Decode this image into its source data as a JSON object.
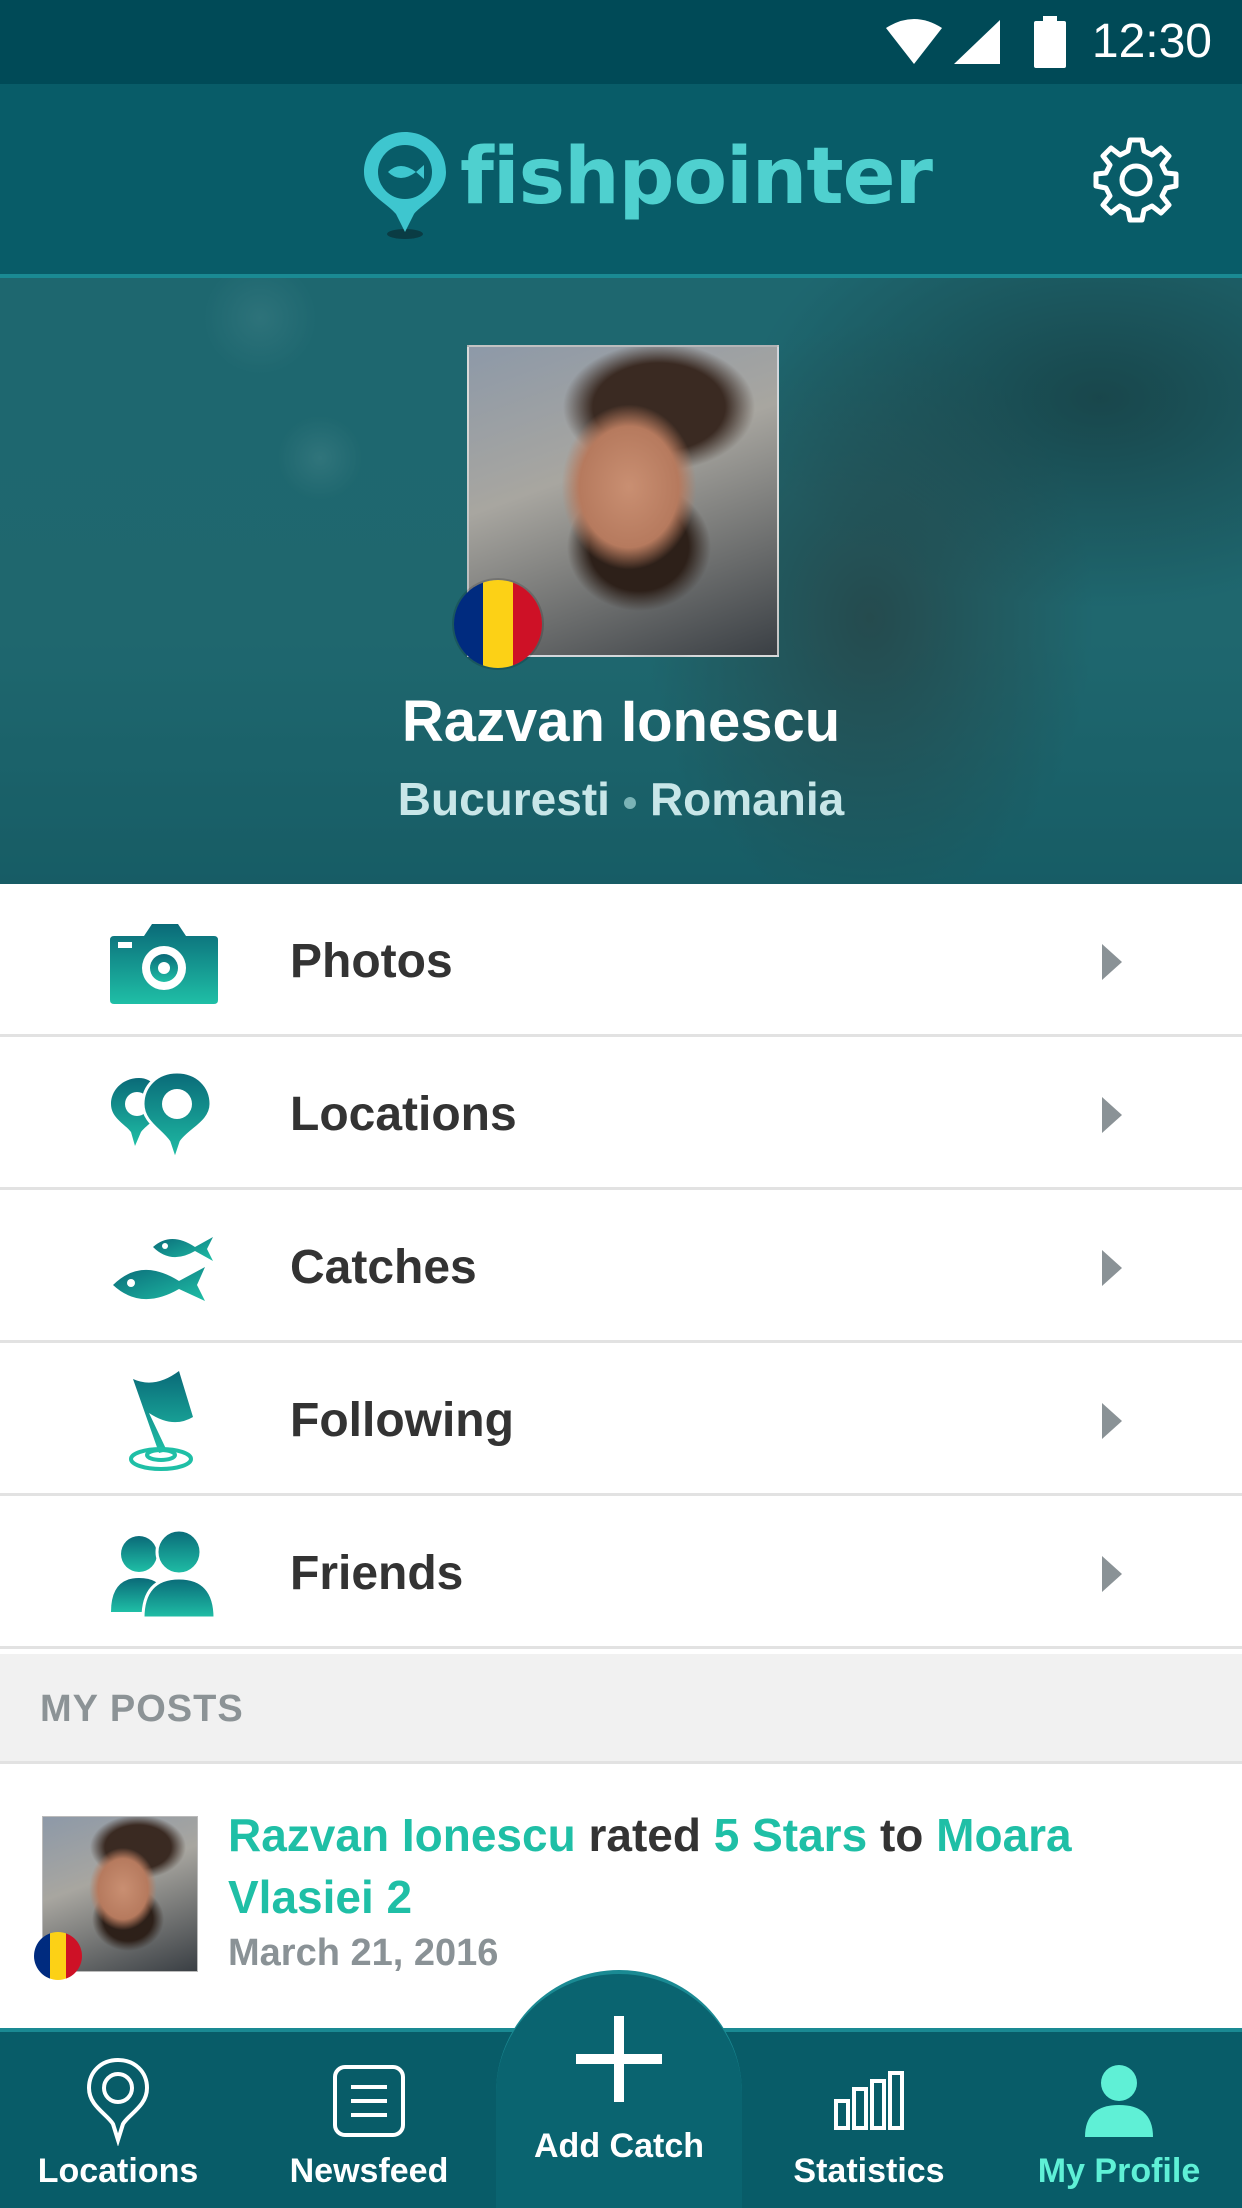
{
  "status_bar": {
    "time": "12:30"
  },
  "app_bar": {
    "logo_text": "fishpointer"
  },
  "profile": {
    "name": "Razvan Ionescu",
    "city": "Bucuresti",
    "country": "Romania",
    "flag_colors": [
      "#002b7f",
      "#fcd116",
      "#ce1126"
    ]
  },
  "menu": {
    "items": [
      {
        "label": "Photos",
        "icon": "camera-icon"
      },
      {
        "label": "Locations",
        "icon": "location-pins-icon"
      },
      {
        "label": "Catches",
        "icon": "fish-icon"
      },
      {
        "label": "Following",
        "icon": "flag-pin-icon"
      },
      {
        "label": "Friends",
        "icon": "friends-icon"
      }
    ]
  },
  "my_posts": {
    "header": "MY POSTS",
    "post": {
      "user": "Razvan Ionescu",
      "verb": "rated",
      "rating": "5 Stars",
      "preposition": "to",
      "location": "Moara Vlasiei 2",
      "date": "March 21, 2016"
    }
  },
  "bottom_nav": {
    "items": [
      {
        "label": "Locations",
        "icon": "location-pin-icon"
      },
      {
        "label": "Newsfeed",
        "icon": "newsfeed-icon"
      },
      {
        "label": "Add Catch",
        "icon": "plus-icon"
      },
      {
        "label": "Statistics",
        "icon": "bar-chart-icon"
      },
      {
        "label": "My Profile",
        "icon": "person-icon"
      }
    ],
    "active": "My Profile"
  },
  "colors": {
    "header_bg": "#085c68",
    "status_bg": "#004a57",
    "accent": "#1fbfa6",
    "logo": "#4fd0cf",
    "active_nav": "#5ff0d6"
  }
}
